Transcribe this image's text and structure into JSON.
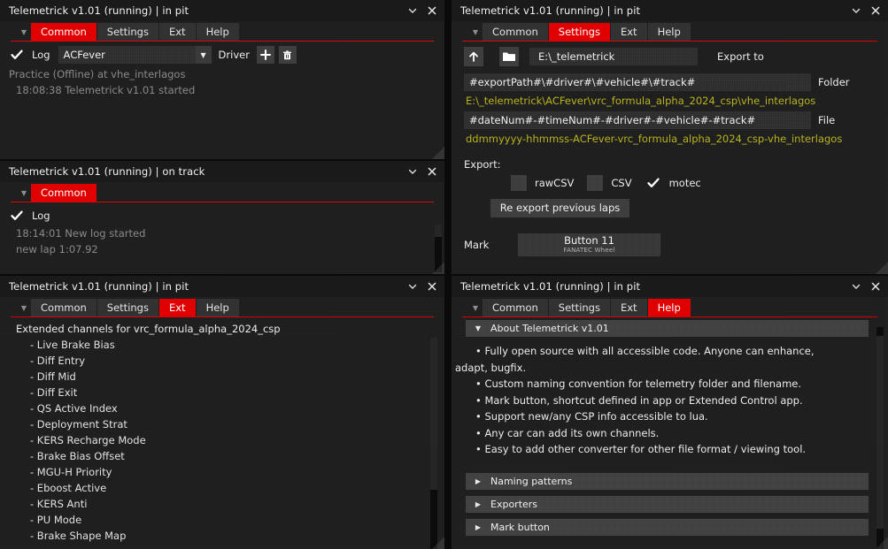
{
  "app": {
    "name": "Telemetrick",
    "version": "v1.01"
  },
  "common_panel": {
    "title": "Telemetrick v1.01  (running) | in pit",
    "tabs": [
      {
        "label": "Common",
        "active": true
      },
      {
        "label": "Settings",
        "active": false
      },
      {
        "label": "Ext",
        "active": false
      },
      {
        "label": "Help",
        "active": false
      }
    ],
    "log_checkbox_label": "Log",
    "log_checked": true,
    "driver_value": "ACFever",
    "driver_label": "Driver",
    "add_icon": "plus-icon",
    "delete_icon": "trash-icon",
    "session_line": "Practice (Offline) at vhe_interlagos",
    "log_lines": [
      "18:08:38  Telemetrick v1.01 started"
    ]
  },
  "ontrack_panel": {
    "title": "Telemetrick v1.01  (running) | on track",
    "tabs": [
      {
        "label": "Common",
        "active": true
      }
    ],
    "log_checkbox_label": "Log",
    "log_checked": true,
    "log_lines": [
      "18:14:01 New log started",
      "new lap 1:07.92"
    ]
  },
  "ext_panel": {
    "title": "Telemetrick v1.01  (running) | in pit",
    "tabs": [
      {
        "label": "Common",
        "active": false
      },
      {
        "label": "Settings",
        "active": false
      },
      {
        "label": "Ext",
        "active": true
      },
      {
        "label": "Help",
        "active": false
      }
    ],
    "heading": "Extended channels for vrc_formula_alpha_2024_csp",
    "channels": [
      "- Live Brake Bias",
      "- Diff Entry",
      "- Diff Mid",
      "- Diff Exit",
      "- QS Active Index",
      "- Deployment Strat",
      "- KERS Recharge Mode",
      "- Brake Bias Offset",
      "- MGU-H Priority",
      "- Eboost Active",
      "- KERS Anti",
      "- PU Mode",
      "- Brake Shape Map"
    ]
  },
  "settings_panel": {
    "title": "Telemetrick v1.01  (running) | in pit",
    "tabs": [
      {
        "label": "Common",
        "active": false
      },
      {
        "label": "Settings",
        "active": true
      },
      {
        "label": "Ext",
        "active": false
      },
      {
        "label": "Help",
        "active": false
      }
    ],
    "up_icon": "arrow-up-icon",
    "folder_icon": "folder-icon",
    "export_path_value": "E:\\_telemetrick",
    "export_to_label": "Export to",
    "folder_pattern_value": "#exportPath#\\#driver#\\#vehicle#\\#track#",
    "folder_label": "Folder",
    "folder_preview": "E:\\_telemetrick\\ACFever\\vrc_formula_alpha_2024_csp\\vhe_interlagos",
    "file_pattern_value": "#dateNum#-#timeNum#-#driver#-#vehicle#-#track#",
    "file_label": "File",
    "file_preview": "ddmmyyyy-hhmmss-ACFever-vrc_formula_alpha_2024_csp-vhe_interlagos",
    "export_label": "Export:",
    "export_formats": [
      {
        "label": "rawCSV",
        "checked": false
      },
      {
        "label": "CSV",
        "checked": false
      },
      {
        "label": "motec",
        "checked": true
      }
    ],
    "re_export_button": "Re export previous laps",
    "mark_label": "Mark",
    "mark_button_main": "Button 11",
    "mark_button_sub": "FANATEC Wheel"
  },
  "help_panel": {
    "title": "Telemetrick v1.01  (running) | in pit",
    "tabs": [
      {
        "label": "Common",
        "active": false
      },
      {
        "label": "Settings",
        "active": false
      },
      {
        "label": "Ext",
        "active": false
      },
      {
        "label": "Help",
        "active": true
      }
    ],
    "about_header": "About  Telemetrick v1.01",
    "about_expanded": true,
    "bullets": [
      "• Fully open source with all accessible code. Anyone can enhance,",
      "adapt, bugfix.",
      "• Custom naming convention for telemetry folder and filename.",
      "• Mark button, shortcut defined in app or Extended Control app.",
      "• Support new/any CSP info accessible to lua.",
      "• Any car can add its own channels.",
      "• Easy to add other converter for other file format / viewing tool."
    ],
    "sections": [
      "Naming patterns",
      "Exporters",
      "Mark button"
    ]
  },
  "colors": {
    "accent_red": "#e00000",
    "path_yellow": "#b8b41e",
    "panel_bg": "#1c1c1c",
    "titlebar_bg": "#1a1a1a",
    "field_bg": "#2b2b2b",
    "text": "#e8e8e8",
    "text_dim": "#8a8a8a"
  }
}
